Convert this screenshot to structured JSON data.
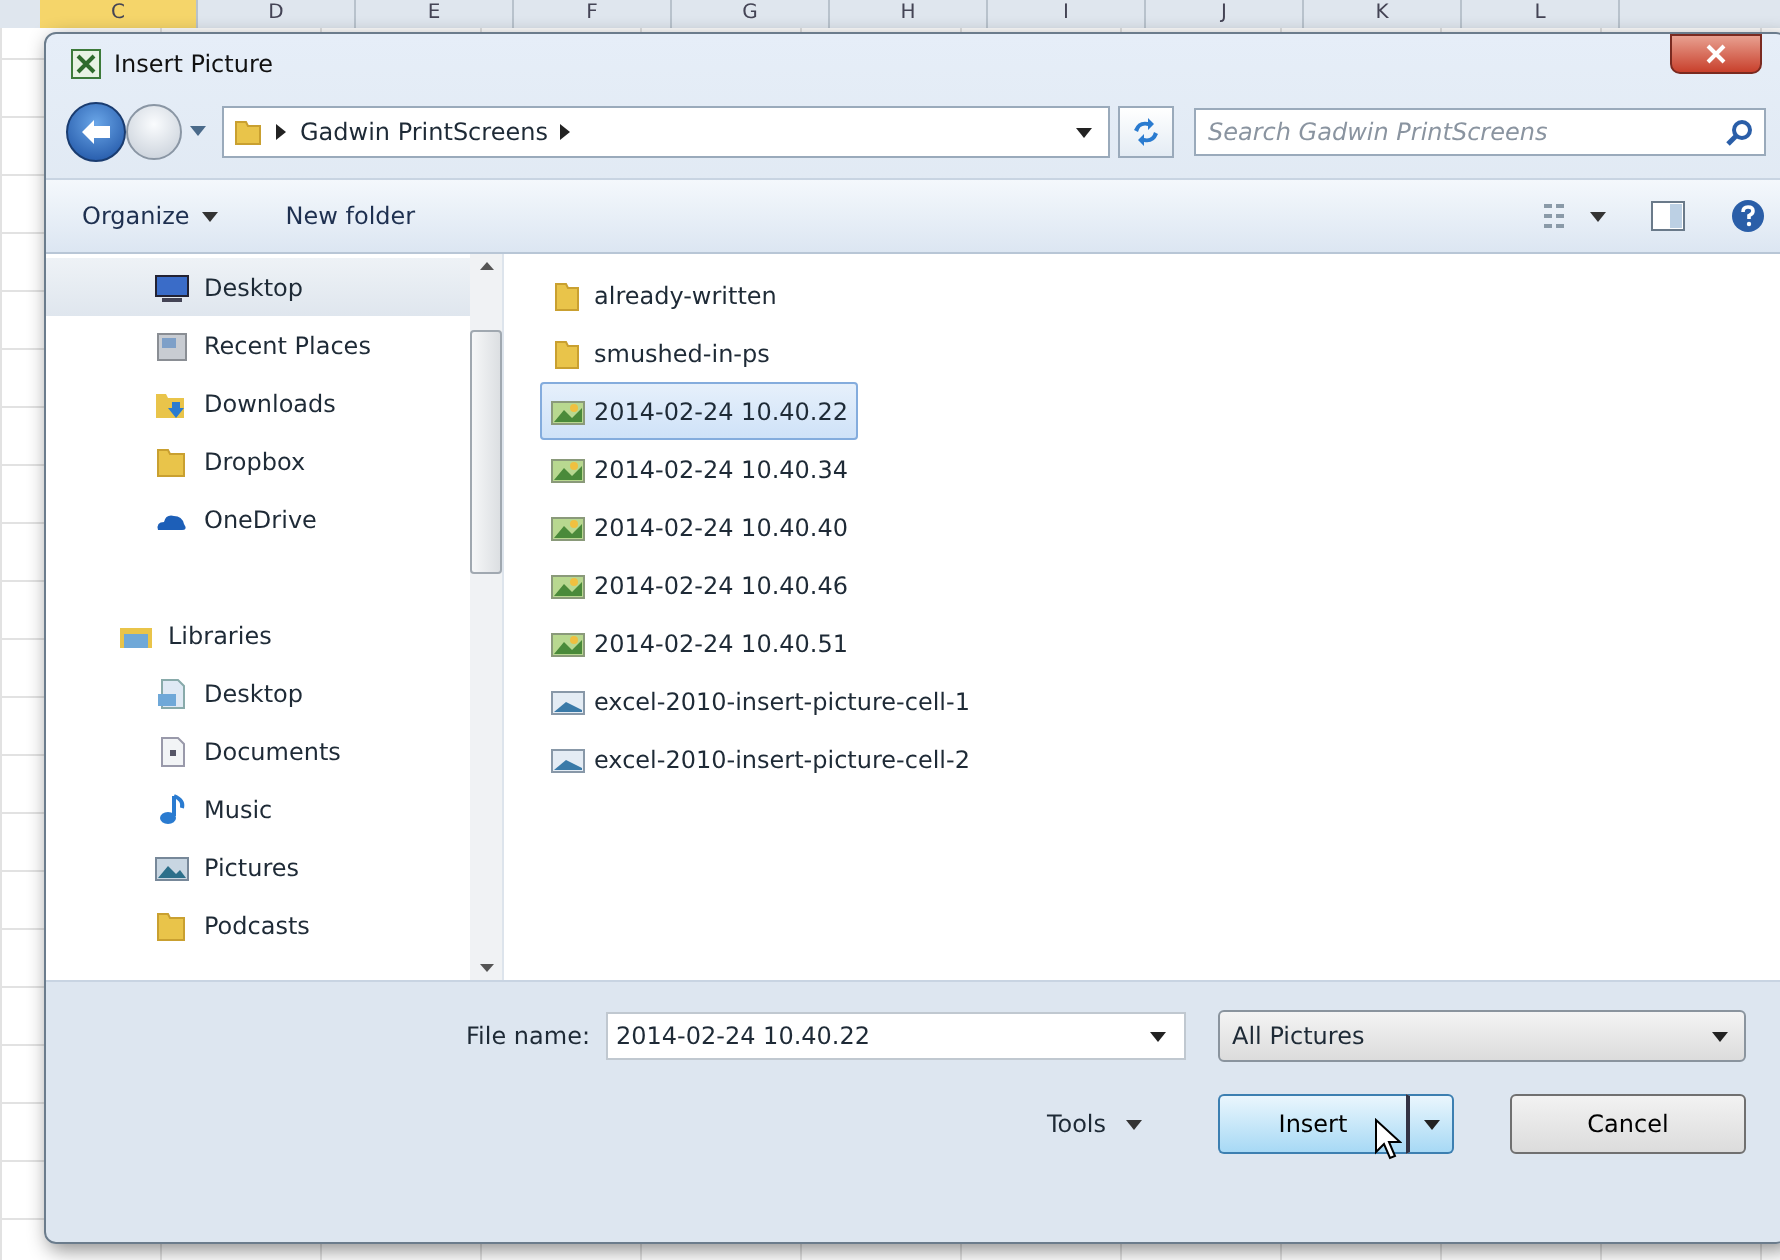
{
  "sheet": {
    "columns": [
      "C",
      "D",
      "E",
      "F",
      "G",
      "H",
      "I",
      "J",
      "K",
      "L"
    ]
  },
  "window": {
    "title": "Insert Picture"
  },
  "address": {
    "path": [
      "Gadwin PrintScreens"
    ],
    "search_placeholder": "Search Gadwin PrintScreens"
  },
  "toolbar": {
    "organize": "Organize",
    "new_folder": "New folder"
  },
  "sidebar": {
    "items": [
      {
        "label": "Desktop",
        "kind": "desktop",
        "selected": true
      },
      {
        "label": "Recent Places",
        "kind": "recent",
        "selected": false
      },
      {
        "label": "Downloads",
        "kind": "downloads",
        "selected": false
      },
      {
        "label": "Dropbox",
        "kind": "folder",
        "selected": false
      },
      {
        "label": "OneDrive",
        "kind": "cloud",
        "selected": false
      },
      {
        "label": "Libraries",
        "kind": "library",
        "selected": false,
        "children": [
          {
            "label": "Desktop",
            "kind": "desktop-doc",
            "selected": false
          },
          {
            "label": "Documents",
            "kind": "document",
            "selected": false
          },
          {
            "label": "Music",
            "kind": "music",
            "selected": false
          },
          {
            "label": "Pictures",
            "kind": "pictures",
            "selected": false
          },
          {
            "label": "Podcasts",
            "kind": "folder",
            "selected": false
          }
        ]
      }
    ]
  },
  "files": [
    {
      "name": "already-written",
      "kind": "folder",
      "selected": false
    },
    {
      "name": "smushed-in-ps",
      "kind": "folder",
      "selected": false
    },
    {
      "name": "2014-02-24 10.40.22",
      "kind": "image",
      "selected": true
    },
    {
      "name": "2014-02-24 10.40.34",
      "kind": "image",
      "selected": false
    },
    {
      "name": "2014-02-24 10.40.40",
      "kind": "image",
      "selected": false
    },
    {
      "name": "2014-02-24 10.40.46",
      "kind": "image",
      "selected": false
    },
    {
      "name": "2014-02-24 10.40.51",
      "kind": "image",
      "selected": false
    },
    {
      "name": "excel-2010-insert-picture-cell-1",
      "kind": "bitmap",
      "selected": false
    },
    {
      "name": "excel-2010-insert-picture-cell-2",
      "kind": "bitmap",
      "selected": false
    }
  ],
  "footer": {
    "file_name_label": "File name:",
    "file_name": "2014-02-24 10.40.22",
    "filter": "All Pictures",
    "tools": "Tools",
    "insert": "Insert",
    "cancel": "Cancel"
  }
}
